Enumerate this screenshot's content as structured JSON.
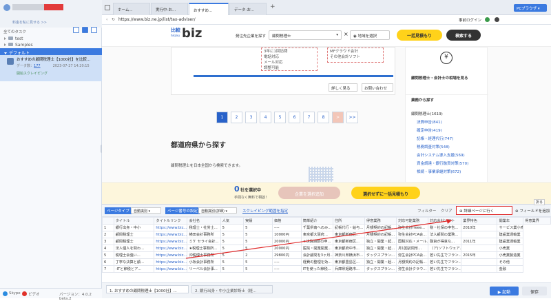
{
  "left_panel": {
    "link": "料金を私に見せる >>",
    "task_label": "全てのタスク",
    "tree": [
      {
        "name": "test"
      },
      {
        "name": "Samples"
      },
      {
        "name": "デフォルト"
      }
    ],
    "task": {
      "title": "おすすめの顧問税理士【1000社】を比較...",
      "count_label": "データ数：",
      "count": "177",
      "date": "2023-07-27 14:20:15",
      "status": "開始スクレイピング"
    },
    "footer": {
      "skype": "Skype",
      "video": "ビデオ",
      "version": "バージョン：4.0.2 beta.2"
    }
  },
  "tabs": [
    {
      "label": "ホーム..."
    },
    {
      "label": "実行中-お..."
    },
    {
      "label": "おすすめ..."
    },
    {
      "label": "データ-お..."
    }
  ],
  "tabbar_right": {
    "login": "事前ログイン",
    "browser": "PCブラウザ"
  },
  "url": "https://www.biz.ne.jp/list/tax-adviser/",
  "site": {
    "logo_hikaku": "比較",
    "logo_hikaku_sub": "hikaku",
    "logo_biz": "biz",
    "search_label": "発注先企業を探す",
    "select_value": "顧問税理士",
    "area_select": "地域を選択",
    "btn_estimate": "一括見積もり",
    "btn_search": "検索する",
    "card_box1": [
      "3年に1回訪問",
      "電話対応",
      "メール対応",
      "調整可能"
    ],
    "card_box2": [
      "MFクラウド会計",
      "その他会計ソフト"
    ],
    "btn_detail": "詳しく見る",
    "btn_contact": "お問い合わせ",
    "pages": [
      "1",
      "2",
      "3",
      "4",
      "5",
      "6",
      "7",
      "8",
      ">",
      ">>"
    ],
    "section_title": "都道府県から探す",
    "section_text": "顧問税理士を日本全国から検索できます。",
    "sidebar_title": "顧問税理士・会計士の相場を見る",
    "sidebar_heading": "業務から探す",
    "categories": [
      "顧問税理士(1619)",
      "決算申告(841)",
      "確定申告(419)",
      "記帳・経理代行(747)",
      "税務調査対策(548)",
      "会計システム導入支援(569)",
      "資金調達・銀行融資対策(570)",
      "相続・事業承継対策(672)"
    ],
    "bottom_count": "0",
    "bottom_count_label": "社を選択中",
    "bottom_sub": "手間なく無料で相談！",
    "bottom_btn1": "企業を選択追加",
    "bottom_btn2": "選択せずに一括見積もり"
  },
  "panel": {
    "page_type_label": "ページタイプ",
    "page_type_value": "自動識別",
    "page_setting_label": "ページ番号の設定",
    "page_setting_value": "自動識別(詳細)",
    "scraping_label": "スクレイピング範囲を指定",
    "filter_label": "フィルター",
    "clear_label": "クリア",
    "detail_btn": "詳細ページに行く",
    "add_field": "フィールドを追加",
    "collapse": "折る",
    "columns": [
      "タイトル",
      "タイトルリンク",
      "会社名",
      "人気",
      "実績",
      "価格",
      "簡単紹介",
      "住所",
      "得意業務",
      "対応可能業務",
      "対応会計ソフト",
      "業界特色",
      "開業年",
      "得意業界"
    ],
    "rows": [
      [
        "1",
        "銀行出身・中小",
        "https://www.biz...",
        "税理士・社労士...",
        "5",
        "5",
        "----",
        "千葉県南へのみ...",
        "記帳代行・給与...",
        "月額契約の記帳...",
        "弥生会計freee...",
        "税・社保の申告...",
        "2010年",
        "サービス業小売"
      ],
      [
        "2",
        "顧問税理士",
        "https://www.biz...",
        "横田会計事務所",
        "5",
        "5",
        "10000円",
        "東京都大阪府...",
        "東京都新宿区...",
        "月額契約の記帳...",
        "弥生会計PCA会...",
        "法人顧問の業務...",
        "",
        "建設業運輸業"
      ],
      [
        "3",
        "顧問税理士",
        "https://www.biz...",
        "ミケ セライ会計...",
        "5",
        "5",
        "20000円",
        "★決算期前の申...",
        "東京都新宿区...",
        "独立・開業・起...",
        "国税対応・メール...",
        "融資が得意な...",
        "2011年",
        "建設業運輸業"
      ],
      [
        "4",
        "法人個人を問わ...",
        "https://www.biz...",
        "★税理士事務所...",
        "5",
        "5",
        "20000円",
        "医院・開業開業...",
        "東京都府中市...",
        "独立・開業・起...",
        "月1回訪問形...",
        "（ア)ソフトウェア...",
        "",
        "小売業"
      ],
      [
        "5",
        "税理士会強い...",
        "https://www.biz...",
        "沖税理士事務所",
        "5",
        "2",
        "29800円",
        "会計顧問を3ヶ月...",
        "神奈川県横浜市...",
        "タックスプラン...",
        "弥生会計PCA会...",
        "若い先生でフラン...",
        "2015年",
        "小売業製造業"
      ],
      [
        "6",
        "丁寧な決算と顧...",
        "https://www.biz...",
        "小坂会計事務所",
        "5",
        "5",
        "----",
        "経費の整理を効...",
        "東京都豊島区...",
        "独立・開業・起...",
        "月額契約の記帳...",
        "若い先生でフラン...",
        "",
        "その他"
      ],
      [
        "7",
        "-ITと節税とア...",
        "https://www.biz...",
        "リーベル会計事...",
        "5",
        "5",
        "----",
        "ITを使った節税...",
        "兵庫県姫路市...",
        "タックスプラン...",
        "弥生会計クラウ...",
        "若い先生でフラン...",
        "",
        "金融"
      ]
    ],
    "bottom_tabs": [
      "1. おすすめの顧問税理士【1000社】...",
      "2. 銀行出身・中小企業診断士（経..."
    ],
    "start_btn": "起動",
    "save_btn": "保存"
  }
}
